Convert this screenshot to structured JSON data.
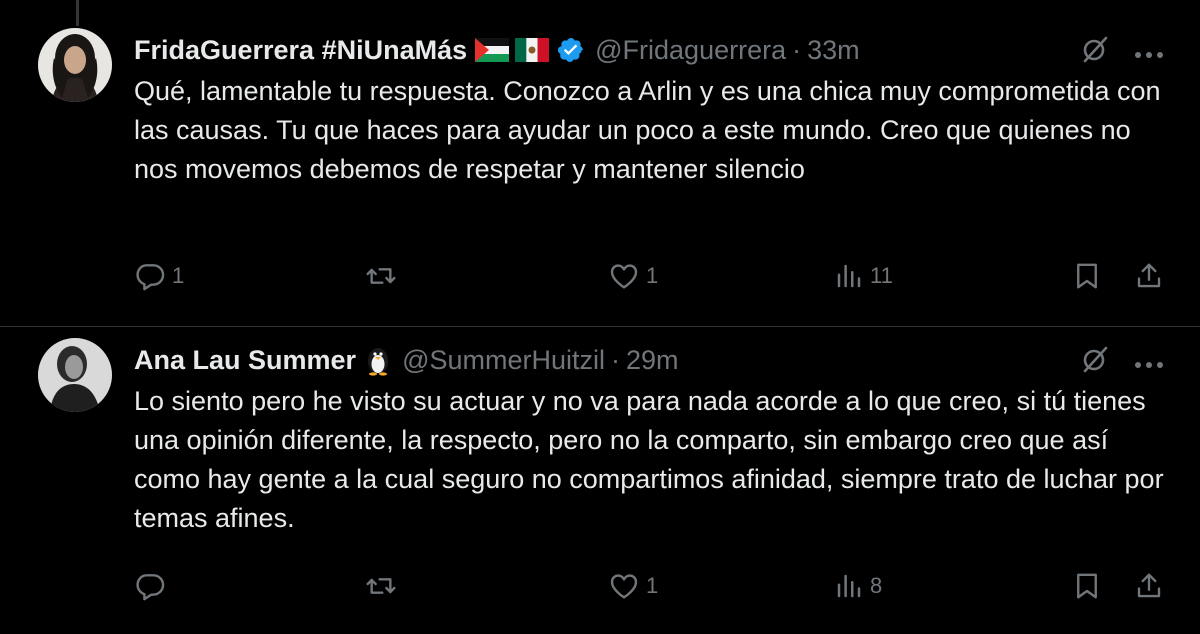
{
  "tweets": [
    {
      "display_name": "FridaGuerrera #NiUnaMás",
      "name_emojis": [
        "flag-palestine-icon",
        "flag-mexico-icon"
      ],
      "verified": true,
      "handle": "@Fridaguerrera",
      "separator": "·",
      "time": "33m",
      "text": "Qué, lamentable tu respuesta. Conozco a Arlin y es una chica muy comprometida con las causas. Tu que haces para ayudar un poco a este mundo. Creo que quienes no nos movemos debemos de respetar y mantener silencio",
      "replies": "1",
      "retweets": "",
      "likes": "1",
      "views": "11"
    },
    {
      "display_name": "Ana Lau Summer",
      "name_emojis": [
        "penguin-icon"
      ],
      "verified": false,
      "handle": "@SummerHuitzil",
      "separator": "·",
      "time": "29m",
      "text": "Lo siento pero he visto su actuar y no va para nada acorde a lo que creo, si tú tienes una opinión diferente, la respecto, pero no la comparto, sin embargo creo que así como hay gente a la cual seguro no compartimos afinidad, siempre trato de luchar por temas afines.",
      "replies": "",
      "retweets": "",
      "likes": "1",
      "views": "8"
    }
  ],
  "colors": {
    "background": "#000000",
    "text": "#e7e9ea",
    "muted": "#71767b",
    "divider": "#2f3336",
    "verified": "#1d9bf0"
  }
}
